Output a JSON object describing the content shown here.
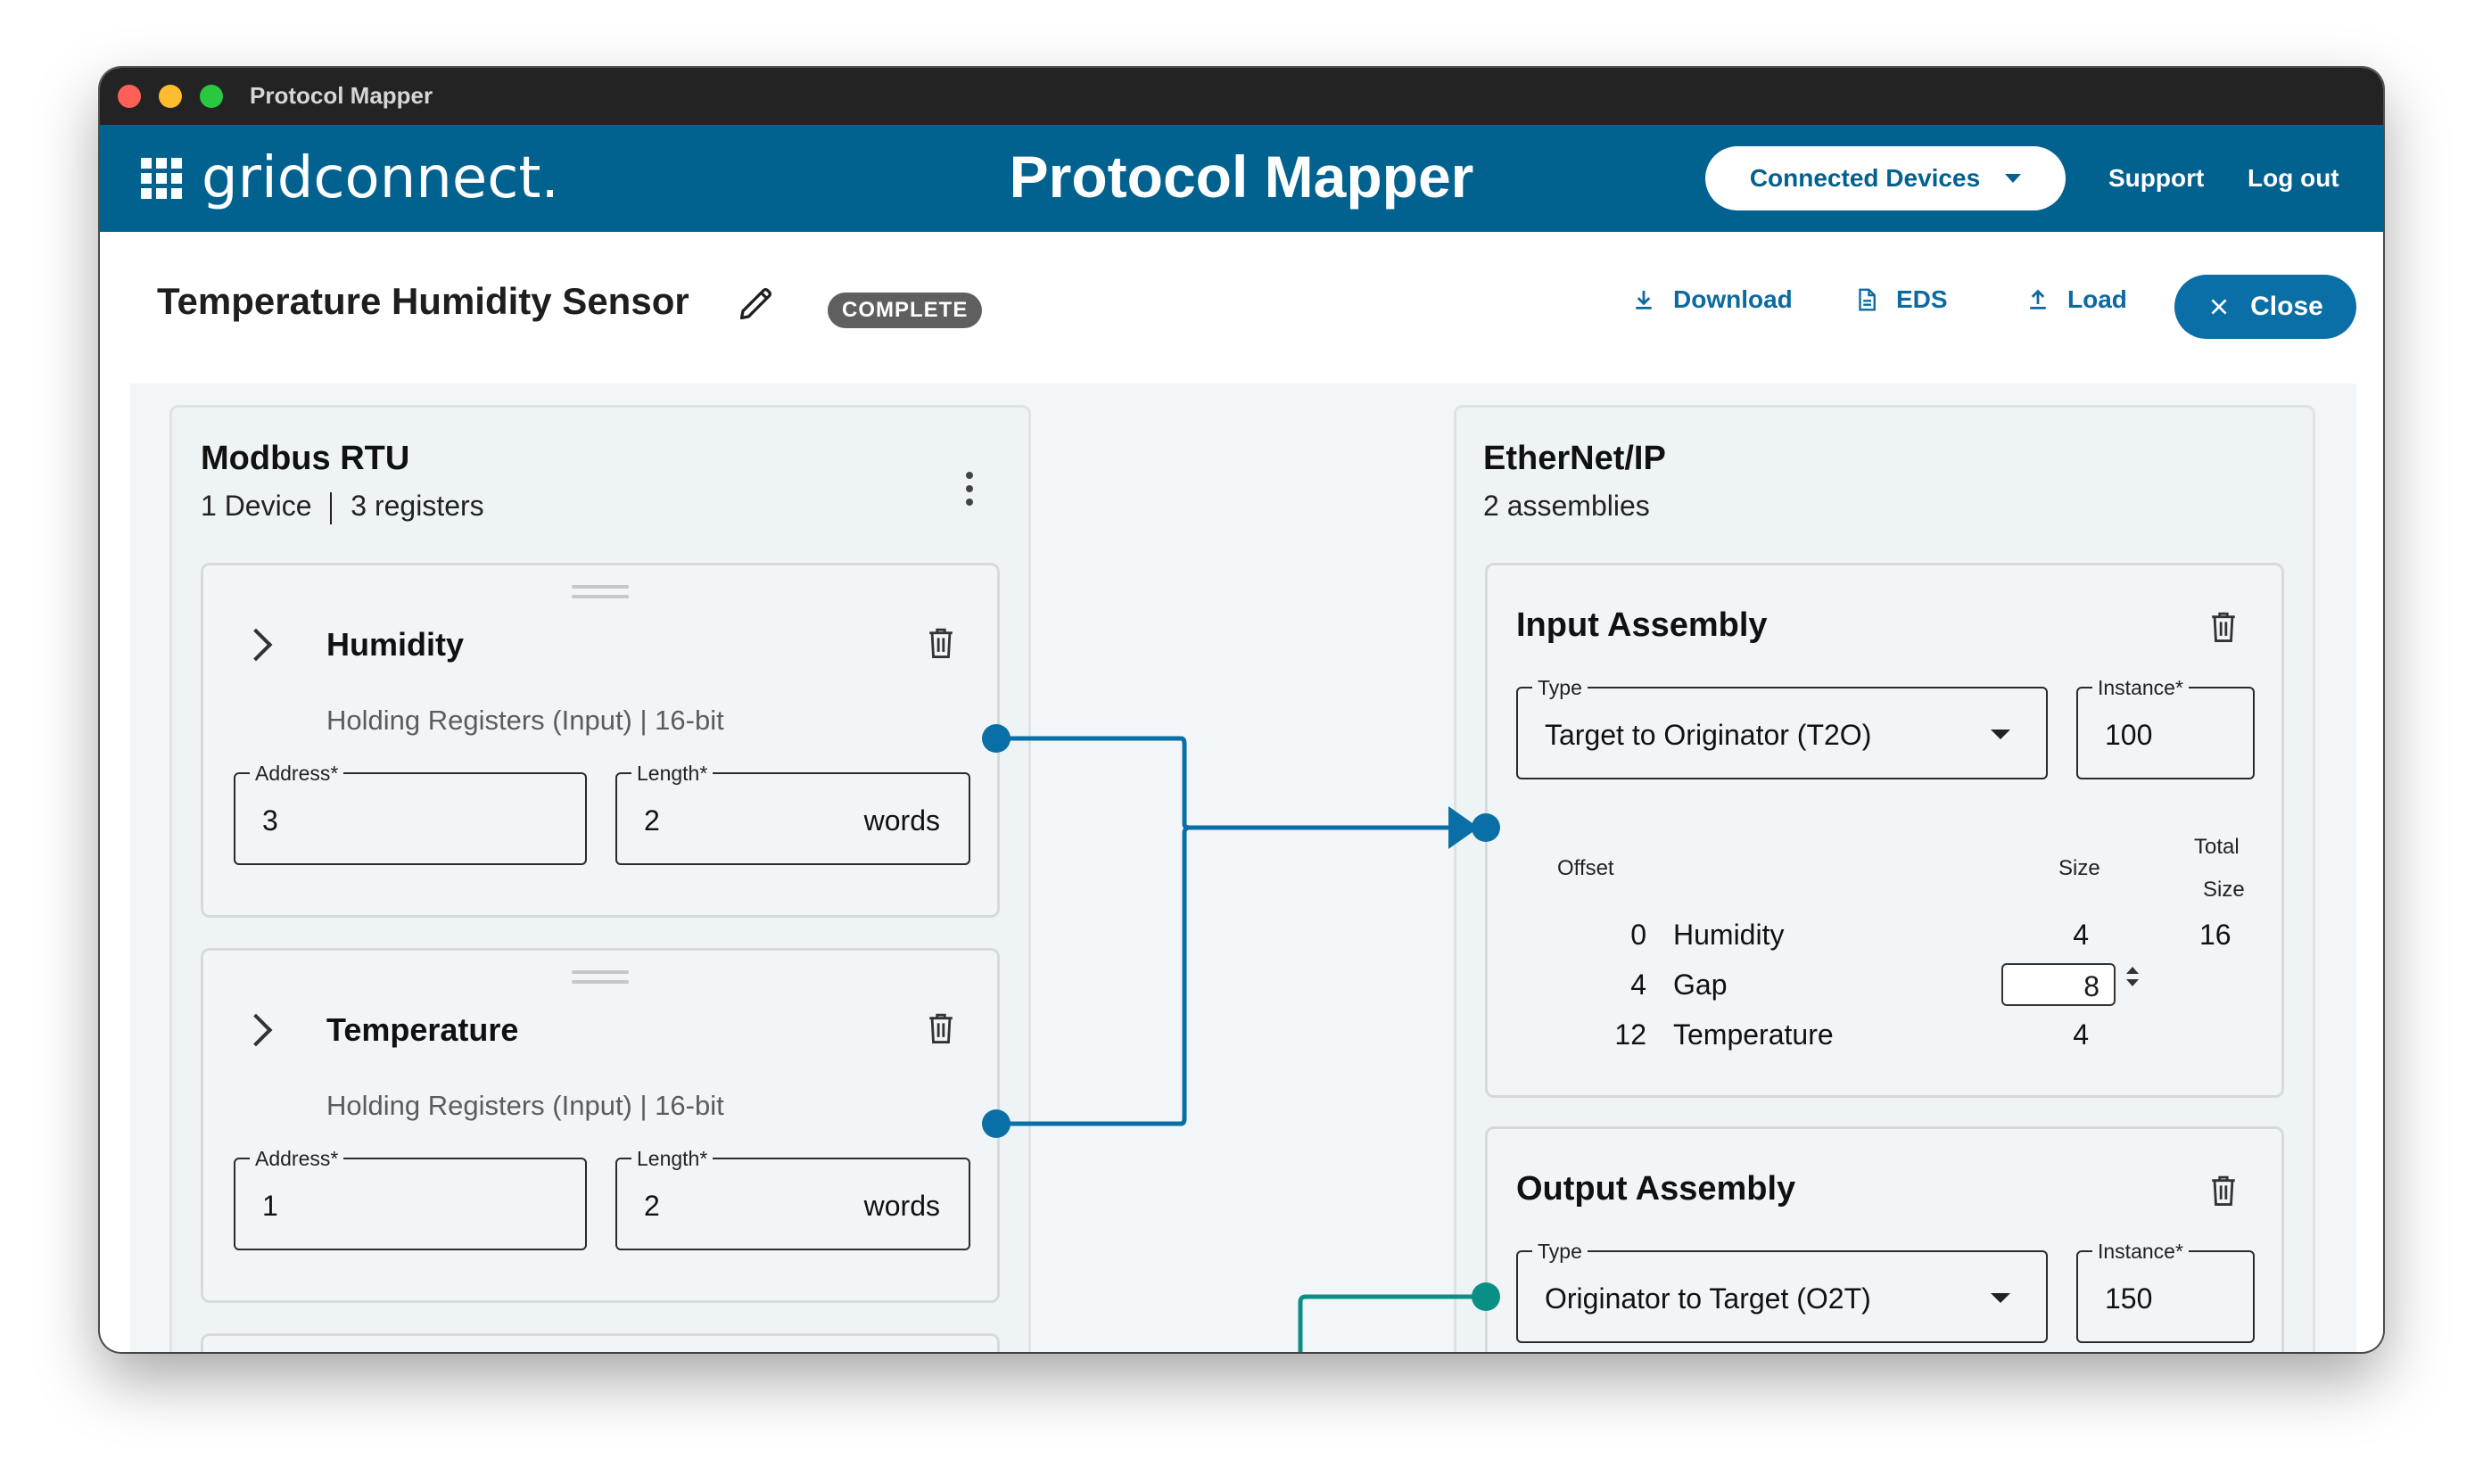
{
  "window": {
    "title": "Protocol Mapper"
  },
  "appbar": {
    "logo": "gridconnect.",
    "title": "Protocol Mapper",
    "devices_label": "Connected Devices",
    "support_label": "Support",
    "logout_label": "Log out"
  },
  "header": {
    "title": "Temperature Humidity Sensor",
    "status": "COMPLETE",
    "download_label": "Download",
    "eds_label": "EDS",
    "load_label": "Load",
    "close_label": "Close"
  },
  "modbus": {
    "title": "Modbus RTU",
    "devices": "1 Device",
    "registers": "3 registers",
    "items": [
      {
        "name": "Humidity",
        "type": "Holding Registers (Input) | 16-bit",
        "address_label": "Address*",
        "address": "3",
        "length_label": "Length*",
        "length": "2",
        "unit": "words"
      },
      {
        "name": "Temperature",
        "type": "Holding Registers (Input) | 16-bit",
        "address_label": "Address*",
        "address": "1",
        "length_label": "Length*",
        "length": "2",
        "unit": "words"
      }
    ]
  },
  "ethernet": {
    "title": "EtherNet/IP",
    "subtitle": "2 assemblies",
    "input": {
      "title": "Input Assembly",
      "type_label": "Type",
      "type_value": "Target to Originator (T2O)",
      "instance_label": "Instance*",
      "instance_value": "100",
      "col_offset": "Offset",
      "col_size": "Size",
      "col_total_1": "Total",
      "col_total_2": "Size",
      "total_size": "16",
      "rows": [
        {
          "offset": "0",
          "name": "Humidity",
          "size": "4"
        },
        {
          "offset": "4",
          "name": "Gap",
          "size": "8"
        },
        {
          "offset": "12",
          "name": "Temperature",
          "size": "4"
        }
      ]
    },
    "output": {
      "title": "Output Assembly",
      "type_label": "Type",
      "type_value": "Originator to Target (O2T)",
      "instance_label": "Instance*",
      "instance_value": "150"
    }
  },
  "colors": {
    "appbar": "#01618f",
    "link": "#0b6aa0",
    "input_connector": "#0a6fa6",
    "output_connector": "#0a8f86"
  }
}
